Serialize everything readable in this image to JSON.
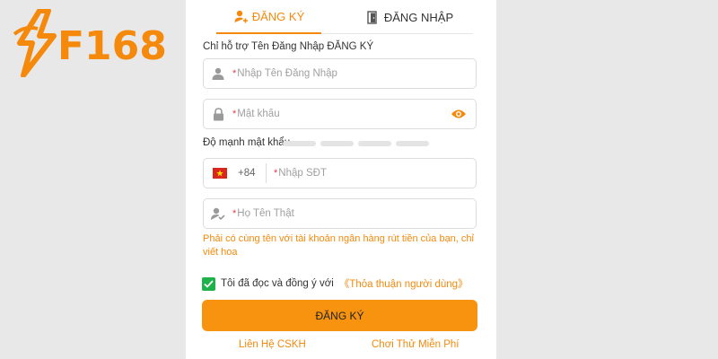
{
  "brand": {
    "logo_text": "F168",
    "accent": "#f5890c"
  },
  "tabs": {
    "register_label": "ĐĂNG KÝ",
    "login_label": "ĐĂNG NHẬP",
    "active": "register"
  },
  "form": {
    "support_label": "Chỉ hỗ trợ Tên Đăng Nhập ĐĂNG KÝ",
    "username_placeholder": "Nhập Tên Đăng Nhập",
    "password_placeholder": "Mật khẩu",
    "strength_label": "Độ mạnh mật khẩu",
    "strength_level": 0,
    "phone_prefix": "+84",
    "phone_placeholder": "Nhập SĐT",
    "fullname_placeholder": "Họ Tên Thật",
    "fullname_note": "Phải có cùng tên với tài khoản ngân hàng rút tiền của bạn, chỉ viết hoa",
    "required_mark": "*",
    "agree_text": "Tôi đã đọc và đồng ý với",
    "agree_link": "《Thỏa thuận người dùng》",
    "agree_checked": true,
    "submit_label": "ĐĂNG KÝ"
  },
  "footer": {
    "support_link": "Liên Hệ CSKH",
    "trial_link": "Chơi Thử Miễn Phí"
  },
  "icons": [
    "bolt-logo-icon",
    "user-add-icon",
    "login-door-icon",
    "user-icon",
    "lock-icon",
    "eye-icon",
    "vietnam-flag-icon",
    "user-verified-icon",
    "check-icon"
  ]
}
